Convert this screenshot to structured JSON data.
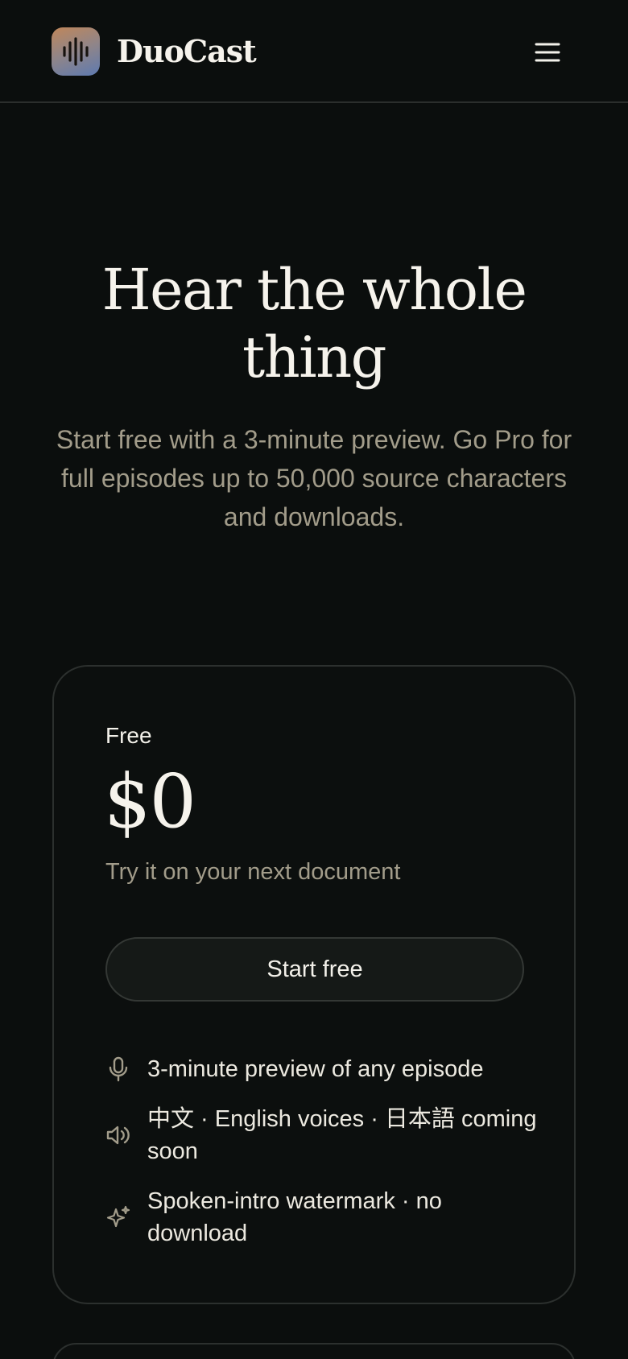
{
  "header": {
    "brand": "DuoCast",
    "logo_icon": "waveform-icon",
    "menu_icon": "hamburger-menu-icon"
  },
  "hero": {
    "title": "Hear the whole thing",
    "subtitle": "Start free with a 3-minute preview. Go Pro for full episodes up to 50,000 source characters and downloads."
  },
  "plans": [
    {
      "name": "Free",
      "price": "$0",
      "tagline": "Try it on your next document",
      "cta_label": "Start free",
      "features": [
        {
          "icon": "microphone-icon",
          "text": "3-minute preview of any episode"
        },
        {
          "icon": "speaker-icon",
          "text": "中文 · English voices · 日本語 coming soon"
        },
        {
          "icon": "sparkle-icon",
          "text": "Spoken-intro watermark · no download"
        }
      ]
    }
  ],
  "colors": {
    "background": "#0b0e0d",
    "text_primary": "#f3f1ea",
    "text_muted": "#a29c8a",
    "border": "#2c302e",
    "logo_gradient_start": "#c0865a",
    "logo_gradient_end": "#5e7ab0"
  }
}
